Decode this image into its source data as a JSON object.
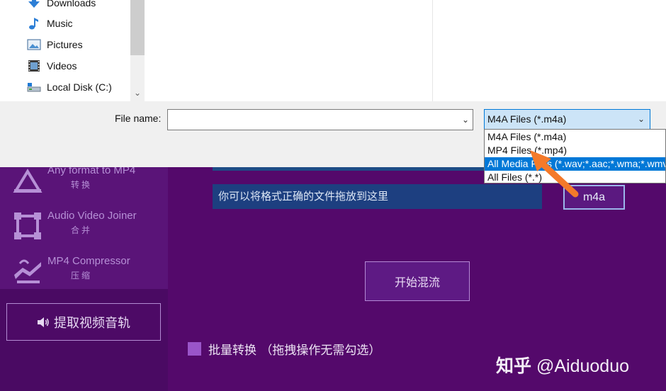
{
  "dialog": {
    "nav_items": [
      {
        "label": "Downloads",
        "icon": "downloads-icon"
      },
      {
        "label": "Music",
        "icon": "music-icon"
      },
      {
        "label": "Pictures",
        "icon": "pictures-icon"
      },
      {
        "label": "Videos",
        "icon": "videos-icon"
      },
      {
        "label": "Local Disk (C:)",
        "icon": "local-disk-icon"
      }
    ],
    "filename_label": "File name:",
    "filename_value": "",
    "filetype_selected": "M4A Files (*.m4a)",
    "filetype_options": [
      {
        "label": "M4A Files (*.m4a)",
        "selected": false
      },
      {
        "label": "MP4 Files (*.mp4)",
        "selected": false
      },
      {
        "label": "All Media Files (*.wav;*.aac;*.wma;*.wmv",
        "selected": true
      },
      {
        "label": "All Files (*.*)",
        "selected": false
      }
    ]
  },
  "app": {
    "sidebar_items": [
      {
        "title": "Any format to MP4",
        "subtitle": "转换"
      },
      {
        "title": "Audio Video Joiner",
        "subtitle": "合并"
      },
      {
        "title": "MP4 Compressor",
        "subtitle": "压缩"
      }
    ],
    "extract_audio_label": "提取视频音轨",
    "drop_zone_text": "你可以将格式正确的文件拖放到这里",
    "format_button_label": "m4a",
    "start_button_label": "开始混流",
    "batch_label": "批量转换 （拖拽操作无需勾选）",
    "watermark_zh": "知乎",
    "watermark_handle": "@Aiduoduo"
  },
  "colors": {
    "app_bg": "#54096b",
    "sidebar_bg": "#4a0a63",
    "selection_blue": "#0078d7",
    "annotation_arrow": "#f47a2a"
  }
}
